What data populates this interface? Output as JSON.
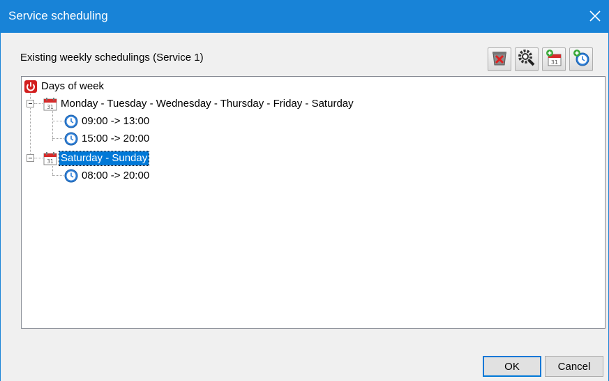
{
  "window": {
    "title": "Service scheduling"
  },
  "heading": "Existing weekly schedulings (Service 1)",
  "toolbar": {
    "buttons": [
      {
        "name": "delete",
        "icon": "delete-icon"
      },
      {
        "name": "settings",
        "icon": "gear-search-icon"
      },
      {
        "name": "add-day",
        "icon": "add-calendar-icon"
      },
      {
        "name": "add-time",
        "icon": "add-clock-icon"
      }
    ]
  },
  "tree": {
    "root": {
      "label": "Days of week",
      "icon": "power-icon"
    },
    "groups": [
      {
        "label": "Monday - Tuesday - Wednesday - Thursday - Friday - Saturday",
        "icon": "calendar-icon",
        "selected": false,
        "times": [
          "09:00 -> 13:00",
          "15:00 -> 20:00"
        ]
      },
      {
        "label": "Saturday - Sunday",
        "icon": "calendar-icon",
        "selected": true,
        "times": [
          "08:00 -> 20:00"
        ]
      }
    ]
  },
  "buttons": {
    "ok": "OK",
    "cancel": "Cancel"
  },
  "colors": {
    "titlebar": "#1883d7",
    "selection": "#0078d7"
  }
}
